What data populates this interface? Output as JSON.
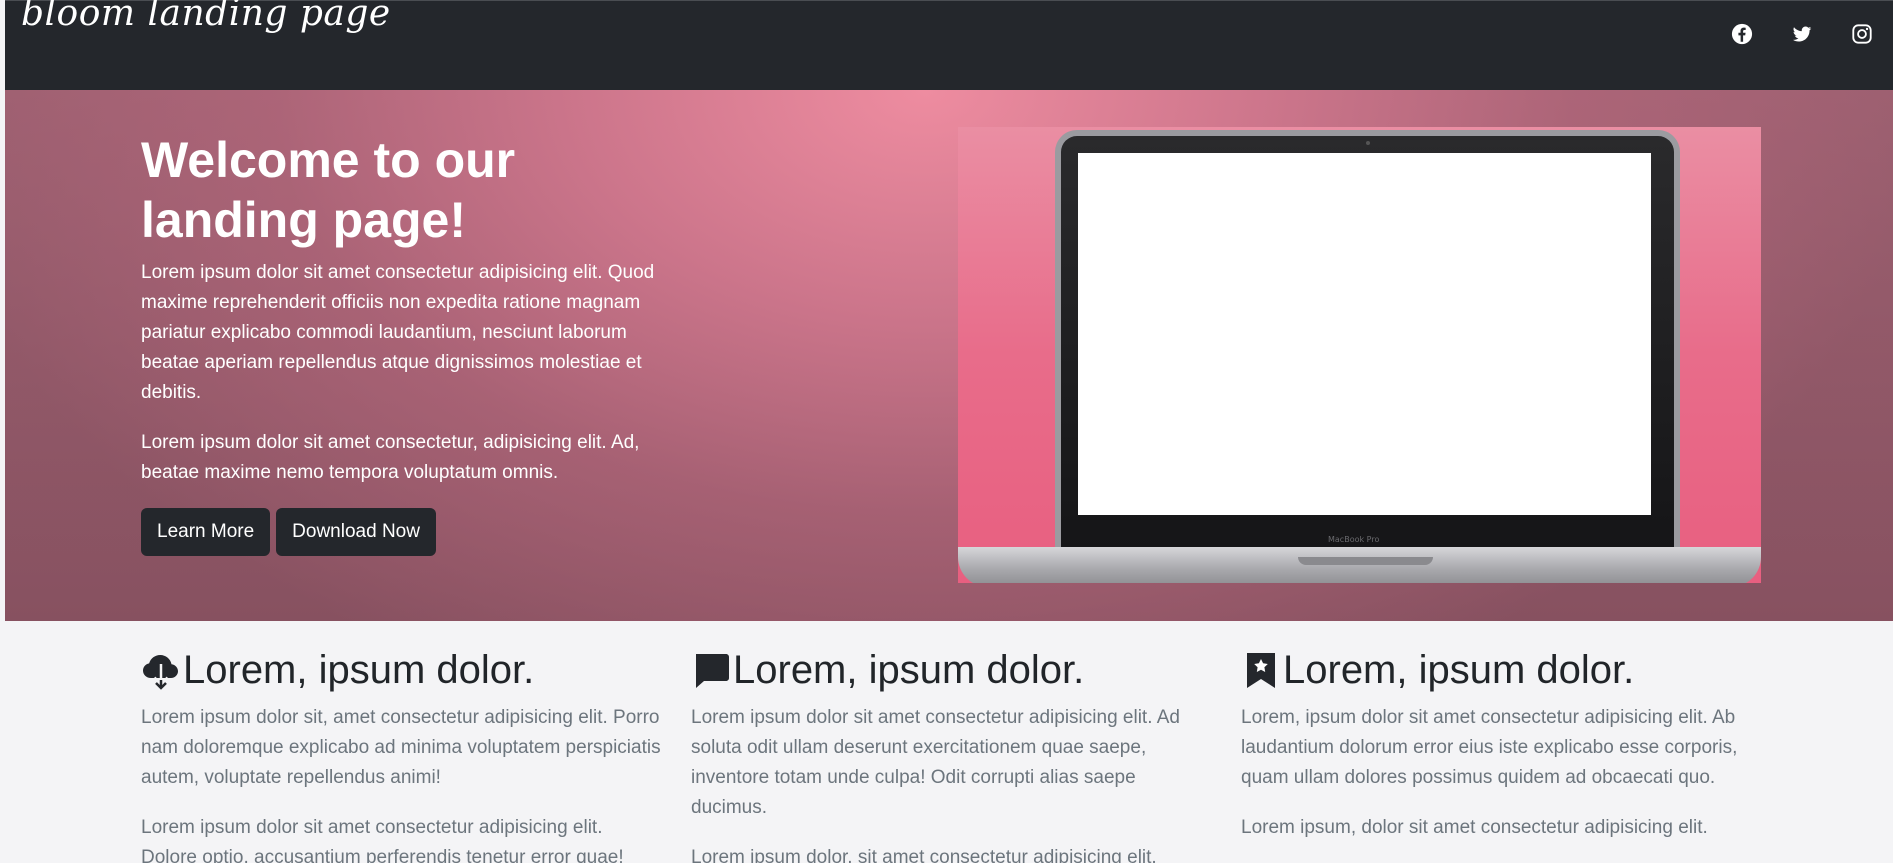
{
  "navbar": {
    "brand": "bloom landing page",
    "social": [
      {
        "icon": "facebook-icon"
      },
      {
        "icon": "twitter-icon"
      },
      {
        "icon": "instagram-icon"
      }
    ]
  },
  "hero": {
    "title": "Welcome to our landing page!",
    "paragraph_1": "Lorem ipsum dolor sit amet consectetur adipisicing elit. Quod maxime reprehenderit officiis non expedita ratione magnam pariatur explicabo commodi laudantium, nesciunt laborum beatae aperiam repellendus atque dignissimos molestiae et debitis.",
    "paragraph_2": "Lorem ipsum dolor sit amet consectetur, adipisicing elit. Ad, beatae maxime nemo tempora voluptatum omnis.",
    "learn_more_label": "Learn More",
    "download_label": "Download Now",
    "image_icon": "laptop-image",
    "laptop_label": "MacBook Pro"
  },
  "features": [
    {
      "icon": "cloud-download-icon",
      "title": "Lorem, ipsum dolor.",
      "paragraph_1": "Lorem ipsum dolor sit, amet consectetur adipisicing elit. Porro nam doloremque explicabo ad minima voluptatem perspiciatis autem, voluptate repellendus animi!",
      "paragraph_2": "Lorem ipsum dolor sit amet consectetur adipisicing elit. Dolore optio, accusantium perferendis tenetur error quae!"
    },
    {
      "icon": "chat-icon",
      "title": "Lorem, ipsum dolor.",
      "paragraph_1": "Lorem ipsum dolor sit amet consectetur adipisicing elit. Ad soluta odit ullam deserunt exercitationem quae saepe, inventore totam unde culpa! Odit corrupti alias saepe ducimus.",
      "paragraph_2": "Lorem ipsum dolor, sit amet consectetur adipisicing elit."
    },
    {
      "icon": "bookmark-star-icon",
      "title": "Lorem, ipsum dolor.",
      "paragraph_1": "Lorem, ipsum dolor sit amet consectetur adipisicing elit. Ab laudantium dolorum error eius iste explicabo esse corporis, quam ullam dolores possimus quidem ad obcaecati quo.",
      "paragraph_2": "Lorem ipsum, dolor sit amet consectetur adipisicing elit."
    }
  ],
  "colors": {
    "navbar_bg": "#24272c",
    "hero_pink": "#e86c8a",
    "button_bg": "#24272c",
    "feature_text": "#6c757d",
    "heading_text": "#212529"
  }
}
